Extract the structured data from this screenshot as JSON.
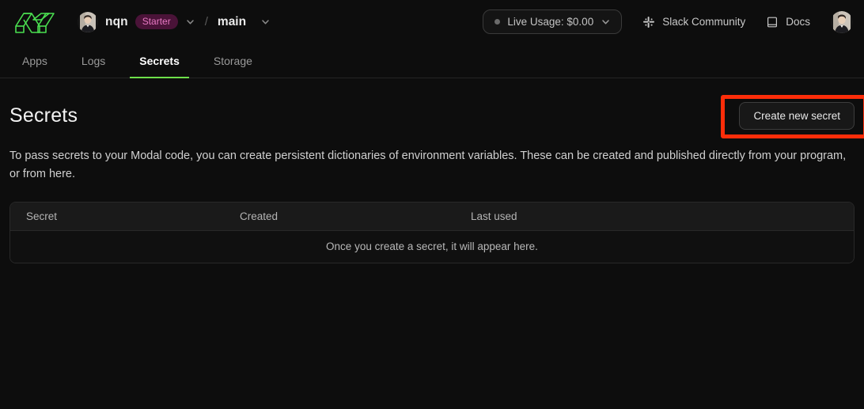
{
  "header": {
    "logo_icon": "modal-logo-icon",
    "org": {
      "avatar_icon": "user-avatar",
      "name": "nqn",
      "plan_badge": "Starter",
      "dropdown_icon": "chevron-down-icon"
    },
    "separator": "/",
    "environment": {
      "name": "main",
      "dropdown_icon": "chevron-down-icon"
    },
    "usage": {
      "status_dot_icon": "status-dot-icon",
      "label": "Live Usage: $0.00",
      "dropdown_icon": "chevron-down-icon"
    },
    "links": [
      {
        "icon": "slack-icon",
        "label": "Slack Community"
      },
      {
        "icon": "book-icon",
        "label": "Docs"
      }
    ],
    "profile_avatar_icon": "user-avatar"
  },
  "tabs": [
    {
      "label": "Apps",
      "active": false
    },
    {
      "label": "Logs",
      "active": false
    },
    {
      "label": "Secrets",
      "active": true
    },
    {
      "label": "Storage",
      "active": false
    }
  ],
  "main": {
    "title": "Secrets",
    "create_button": "Create new secret",
    "description": "To pass secrets to your Modal code, you can create persistent dictionaries of environment variables. These can be created and published directly from your program, or from here.",
    "table": {
      "columns": [
        "Secret",
        "Created",
        "Last used"
      ],
      "empty_message": "Once you create a secret, it will appear here.",
      "rows": []
    }
  },
  "annotation": {
    "name": "create-new-secret-highlight",
    "color": "#fc2d09"
  },
  "colors": {
    "background": "#0d0d0d",
    "accent_green": "#6ee04a",
    "badge_bg": "#4a1338",
    "badge_text": "#e879c4",
    "highlight": "#fc2d09"
  }
}
